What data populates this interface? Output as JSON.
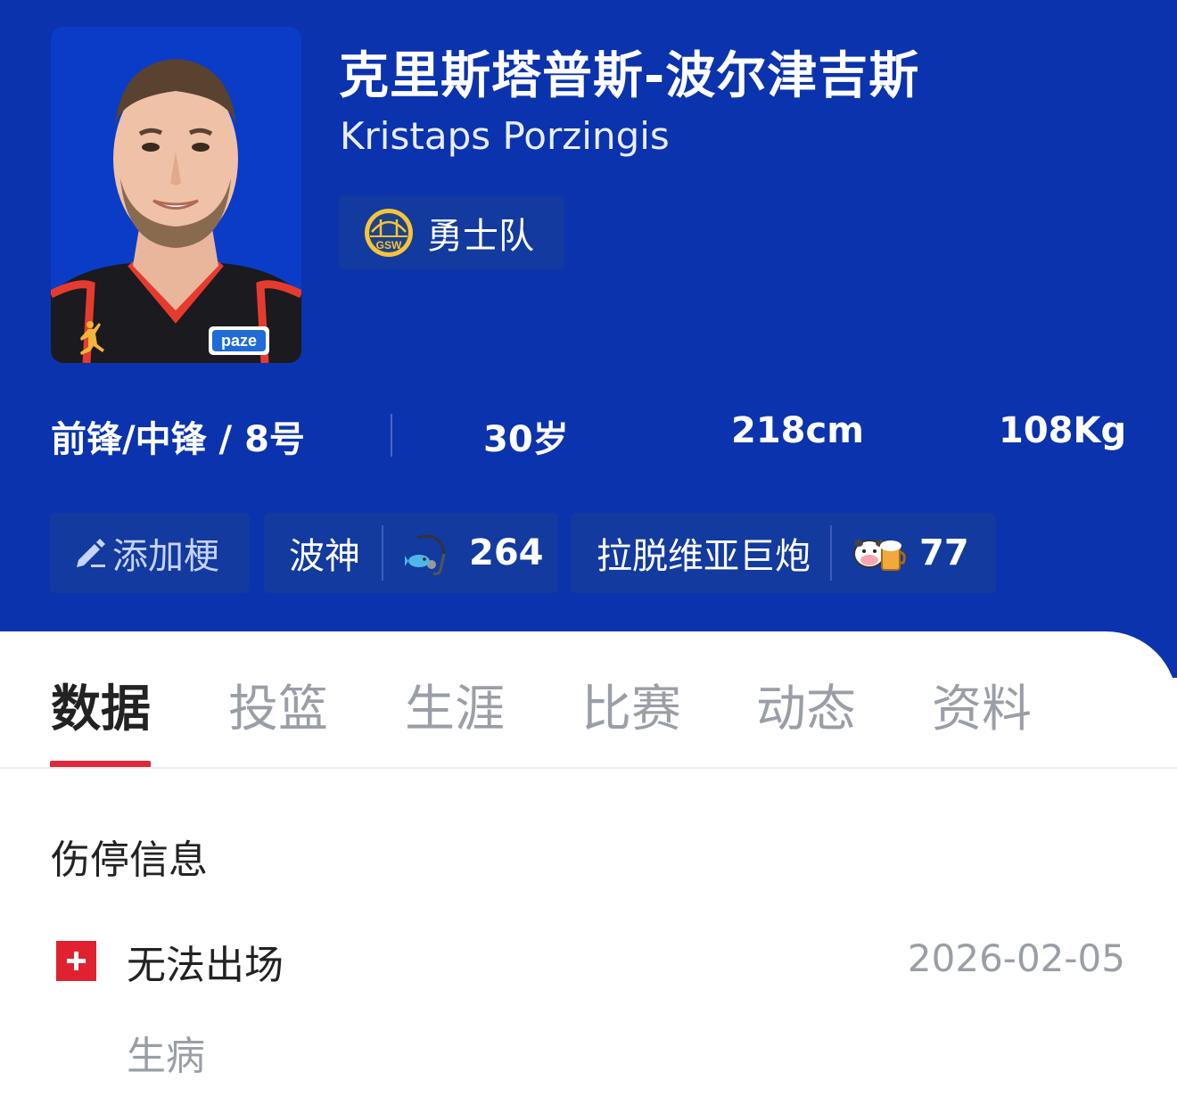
{
  "player": {
    "name_cn": "克里斯塔普斯-波尔津吉斯",
    "name_en": "Kristaps Porzingis",
    "photo_sponsor": "paze",
    "team": {
      "name": "勇士队",
      "logo_text": "GSW",
      "logo_icon": "golden-state-warriors-logo"
    },
    "position_number": "前锋/中锋 / 8号",
    "age": "30岁",
    "height": "218cm",
    "weight": "108Kg"
  },
  "tags": {
    "add_label": "添加梗",
    "add_icon": "pencil-icon",
    "items": [
      {
        "text": "波神",
        "emoji": "fish-on-hook-emoji",
        "count": "264"
      },
      {
        "text": "拉脱维亚巨炮",
        "emoji": "cow-beer-emoji",
        "count": "77"
      }
    ]
  },
  "tabs": [
    "数据",
    "投篮",
    "生涯",
    "比赛",
    "动态",
    "资料"
  ],
  "active_tab": "数据",
  "injury": {
    "section_title": "伤停信息",
    "status": "无法出场",
    "date": "2026-02-05",
    "reason": "生病",
    "icon": "medical-cross-icon"
  },
  "colors": {
    "header_bg": "#0b33ad",
    "chip_bg": "#123a9f",
    "accent": "#e02837",
    "muted_text": "#9a9ea6"
  }
}
